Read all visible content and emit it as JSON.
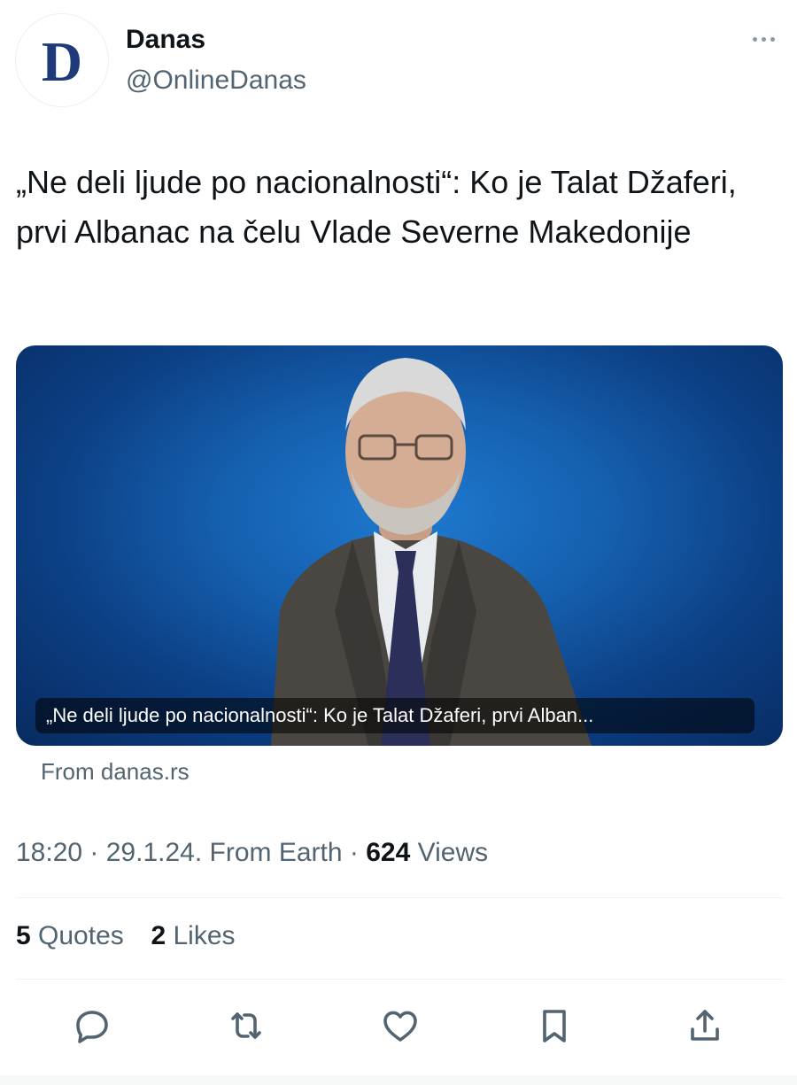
{
  "author": {
    "avatar_letter": "D",
    "display_name": "Danas",
    "handle": "@OnlineDanas"
  },
  "tweet": {
    "text": "„Ne deli ljude po nacionalnosti“: Ko je Talat Džaferi, prvi Albanac na čelu Vlade Severne Makedonije"
  },
  "link_card": {
    "caption": "„Ne deli ljude po nacionalnosti“: Ko je Talat Džaferi, prvi Alban...",
    "source": "From danas.rs"
  },
  "meta": {
    "time": "18:20",
    "date": "29.1.24.",
    "source": "From Earth",
    "views_count": "624",
    "views_label": "Views"
  },
  "stats": {
    "quotes_count": "5",
    "quotes_label": "Quotes",
    "likes_count": "2",
    "likes_label": "Likes"
  },
  "actions": [
    "reply-icon",
    "retweet-icon",
    "like-icon",
    "bookmark-icon",
    "share-icon"
  ],
  "colors": {
    "text": "#0f1419",
    "secondary": "#536471",
    "brand_navy": "#1f3a7a",
    "card_blue": "#155fae"
  }
}
